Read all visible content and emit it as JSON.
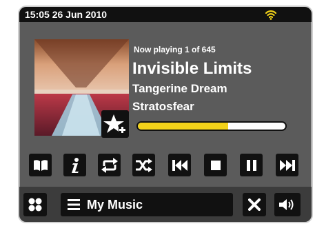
{
  "status": {
    "datetime": "15:05 26 Jun 2010",
    "wifi_icon": "wifi-icon",
    "wifi_color": "#f2d21a"
  },
  "now_playing": {
    "position_text": "Now playing 1 of 645",
    "title": "Invisible Limits",
    "artist": "Tangerine Dream",
    "album": "Stratosfear",
    "progress_fraction": 0.61
  },
  "controls": [
    {
      "name": "bookmarks-button",
      "icon": "book-icon"
    },
    {
      "name": "info-button",
      "icon": "info-icon"
    },
    {
      "name": "repeat-button",
      "icon": "repeat-icon"
    },
    {
      "name": "shuffle-button",
      "icon": "shuffle-icon"
    },
    {
      "name": "previous-button",
      "icon": "skip-back-icon"
    },
    {
      "name": "stop-button",
      "icon": "stop-icon"
    },
    {
      "name": "pause-button",
      "icon": "pause-icon"
    },
    {
      "name": "next-button",
      "icon": "skip-forward-icon"
    }
  ],
  "bottom": {
    "source_label": "My Music",
    "menu_icon": "menu-icon",
    "close_icon": "close-icon",
    "volume_icon": "volume-icon"
  },
  "colors": {
    "accent": "#f2d21a",
    "panel": "#5b5b5b",
    "button": "#111111"
  }
}
